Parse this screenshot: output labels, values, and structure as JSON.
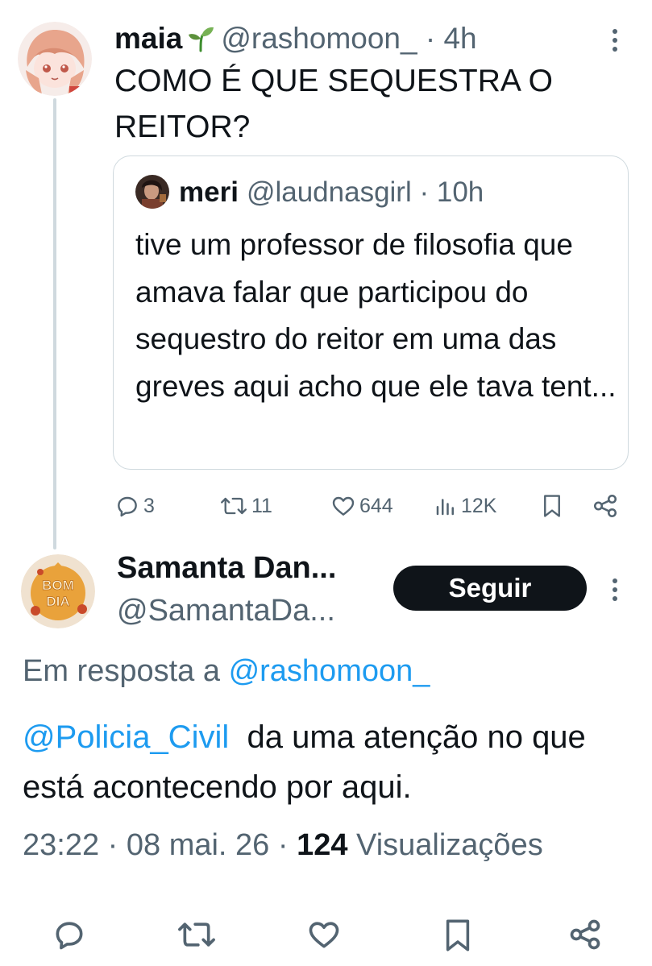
{
  "top_tweet": {
    "name": "maia",
    "handle": "@rashomoon_",
    "time": "4h",
    "text": "COMO É QUE SEQUESTRA O REITOR?"
  },
  "quoted_tweet": {
    "name": "meri",
    "handle": "@laudnasgirl",
    "time": "10h",
    "text": "tive um professor de filosofia que amava falar que participou do sequestro do reitor em uma das greves aqui acho que ele tava tent..."
  },
  "top_actions": {
    "replies": "3",
    "reposts": "11",
    "likes": "644",
    "views": "12K"
  },
  "reply_tweet": {
    "name": "Samanta Dan...",
    "handle": "@SamantaDa...",
    "follow_label": "Seguir",
    "avatar_text": [
      "BOM",
      "DIA"
    ],
    "reply_prefix": "Em resposta a",
    "reply_to": "@rashomoon_",
    "mention": "@Policia_Civil",
    "text": "da uma atenção no que está acontecendo por aqui.",
    "timestamp": "23:22 · 08 mai. 26 ·",
    "views_count": "124",
    "views_label": "Visualizações"
  },
  "colors": {
    "text": "#0f1419",
    "secondary": "#536471",
    "link": "#1d9bf0",
    "border": "#cfd9de"
  }
}
